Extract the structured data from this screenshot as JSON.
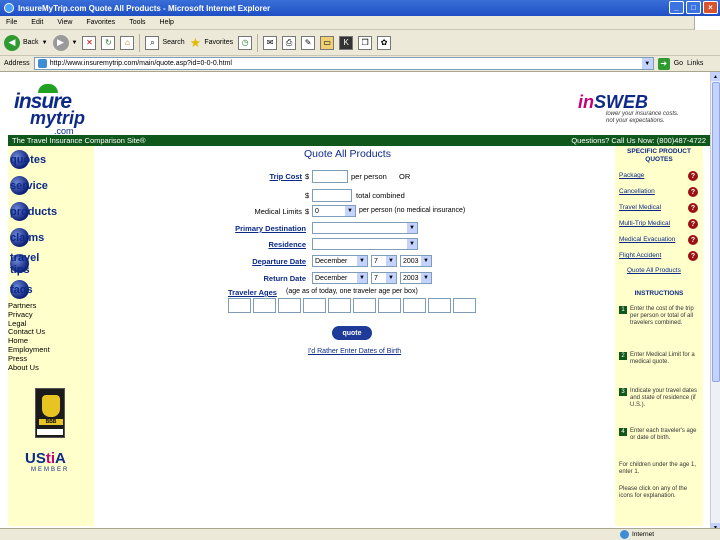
{
  "window": {
    "title": "InsureMyTrip.com Quote All Products - Microsoft Internet Explorer"
  },
  "menu": [
    "File",
    "Edit",
    "View",
    "Favorites",
    "Tools",
    "Help"
  ],
  "toolbar": {
    "back_label": "Back",
    "search_label": "Search",
    "favorites_label": "Favorites"
  },
  "address": {
    "label": "Address",
    "url": "http://www.insuremytrip.com/main/quote.asp?id=0-0-0.html",
    "go_label": "Go",
    "links_label": "Links"
  },
  "logo": {
    "line1": "insure",
    "line2": "mytrip",
    "line3": ".com"
  },
  "insweb": {
    "brand_a": "in",
    "brand_b": "SWEB",
    "tagline": "lower your insurance costs. not your expectations."
  },
  "greenbar": {
    "left": "The Travel Insurance Comparison Site®",
    "right": "Questions? Call Us Now: (800)487-4722"
  },
  "nav": {
    "items": [
      "quotes",
      "service",
      "products",
      "claims",
      "travel tips",
      "faqs"
    ],
    "links": [
      "Partners",
      "Privacy",
      "Legal",
      "Contact Us",
      "Home",
      "Employment",
      "Press",
      "About Us"
    ],
    "bbb_text": "BBB",
    "ustia": {
      "a": "US",
      "b": "ti",
      "c": "A",
      "member": "MEMBER"
    }
  },
  "form": {
    "heading": "Quote All Products",
    "trip_cost_label": "Trip Cost",
    "dollar": "$",
    "per_person": "per person",
    "or": "OR",
    "total_combined": "total combined",
    "medical_label": "Medical Limits",
    "medical_value": "0",
    "medical_note": "per person (no medical insurance)",
    "destination_label": "Primary Destination",
    "residence_label": "Residence",
    "departure_label": "Departure Date",
    "return_label": "Return Date",
    "departure": {
      "month": "December",
      "day": "7",
      "year": "2003"
    },
    "return": {
      "month": "December",
      "day": "7",
      "year": "2003"
    },
    "ages_label": "Traveler Ages",
    "ages_note": "(age as of today, one traveler age per box)",
    "quote_button": "quote",
    "birthdate_link": "I'd Rather Enter Dates of Birth"
  },
  "right": {
    "heading": "SPECIFIC PRODUCT QUOTES",
    "products": [
      "Package",
      "Cancellation",
      "Travel Medical",
      "Multi-Trip Medical",
      "Medical Evacuation",
      "Flight Accident"
    ],
    "all_products": "Quote All Products",
    "qmark": "?",
    "instructions_heading": "INSTRUCTIONS",
    "instructions": [
      "Enter the cost of the trip per person or total of all travelers combined.",
      "Enter Medical Limit for a medical quote.",
      "Indicate your travel dates and state of residence (if U.S.).",
      "Enter each traveler's age or date of birth."
    ],
    "note1": "For children under the age 1, enter 1.",
    "note2": "Please click on any of the icons for explanation."
  },
  "status": {
    "zone": "Internet"
  }
}
